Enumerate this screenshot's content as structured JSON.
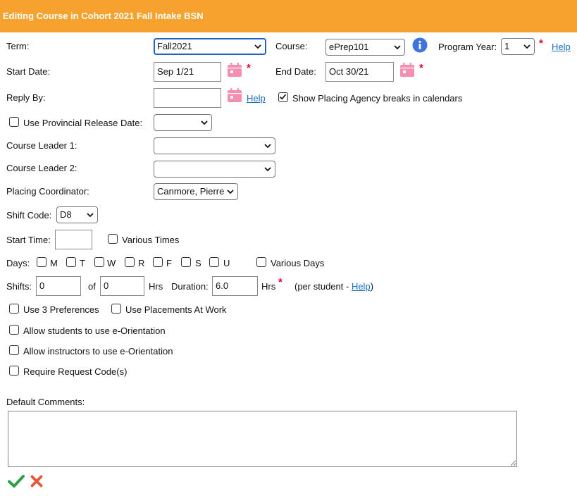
{
  "header": {
    "title": "Editing Course in Cohort 2021 Fall Intake BSN"
  },
  "term": {
    "label": "Term:",
    "value": "Fall2021"
  },
  "course": {
    "label": "Course:",
    "value": "ePrep101"
  },
  "program_year": {
    "label": "Program Year:",
    "value": "1",
    "help": "Help"
  },
  "start_date": {
    "label": "Start Date:",
    "value": "Sep 1/21"
  },
  "end_date": {
    "label": "End Date:",
    "value": "Oct 30/21"
  },
  "reply_by": {
    "label": "Reply By:",
    "value": "",
    "help": "Help"
  },
  "show_breaks": {
    "label": "Show Placing Agency breaks in calendars",
    "checked": true
  },
  "provincial_release": {
    "label": "Use Provincial Release Date:",
    "value": ""
  },
  "course_leader_1": {
    "label": "Course Leader 1:",
    "value": ""
  },
  "course_leader_2": {
    "label": "Course Leader 2:",
    "value": ""
  },
  "placing_coordinator": {
    "label": "Placing Coordinator:",
    "value": "Canmore, Pierre"
  },
  "shift_code": {
    "label": "Shift Code:",
    "value": "D8"
  },
  "start_time": {
    "label": "Start Time:",
    "value": ""
  },
  "various_times": {
    "label": "Various Times"
  },
  "days": {
    "label": "Days:",
    "items": [
      "M",
      "T",
      "W",
      "R",
      "F",
      "S",
      "U"
    ],
    "various_label": "Various Days"
  },
  "shifts": {
    "label": "Shifts:",
    "value": "0",
    "of_label": "of",
    "of_value": "0",
    "hrs_label": "Hrs"
  },
  "duration": {
    "label": "Duration:",
    "value": "6.0",
    "hrs_label": "Hrs",
    "note_prefix": "(per student - ",
    "help": "Help",
    "note_suffix": ")"
  },
  "options": {
    "use_3_prefs": "Use 3 Preferences",
    "use_placements_at_work": "Use Placements At Work",
    "allow_students": "Allow students to use e-Orientation",
    "allow_instructors": "Allow instructors to use e-Orientation",
    "require_request_code": "Require Request Code(s)"
  },
  "default_comments": {
    "label": "Default Comments:",
    "value": ""
  },
  "colors": {
    "header": "#f7a12f",
    "save": "#2e9e4a",
    "cancel": "#e4573d",
    "calendar": "#f48fb1",
    "info": "#3f73e0"
  },
  "icons": {
    "save": "checkmark-icon",
    "cancel": "x-icon",
    "calendar": "calendar-icon",
    "info": "info-icon"
  }
}
